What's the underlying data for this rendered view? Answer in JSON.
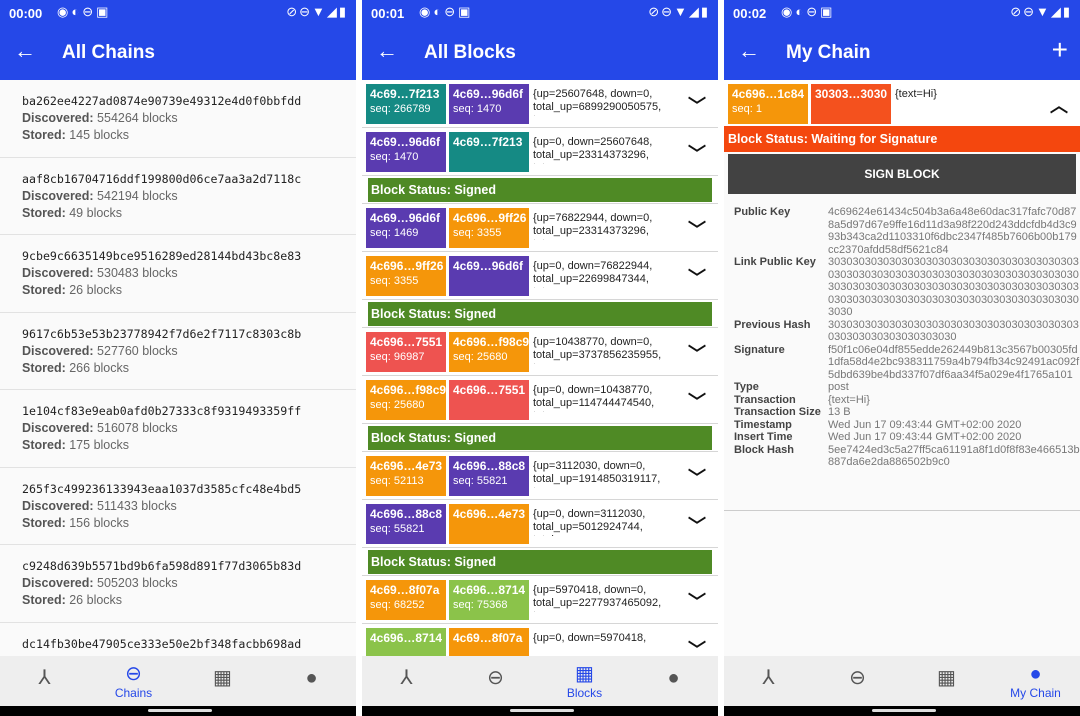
{
  "icons": {
    "back": "arrow-left-icon",
    "plus": "plus-icon",
    "chevron_down": "chevron-down-icon",
    "chevron_up": "chevron-up-icon"
  },
  "nav": {
    "items": [
      {
        "icon": "network-icon",
        "glyph": "⅄",
        "label": ""
      },
      {
        "icon": "link-icon",
        "glyph": "⊖",
        "label": "Chains"
      },
      {
        "icon": "grid-icon",
        "glyph": "▦",
        "label": "Blocks"
      },
      {
        "icon": "person-icon",
        "glyph": "●",
        "label": "My Chain"
      }
    ]
  },
  "screen1": {
    "time": "00:00",
    "title": "All Chains",
    "discovered_label": "Discovered:",
    "stored_label": "Stored:",
    "chains": [
      {
        "hash": "ba262ee4227ad0874e90739e49312e4d0f0bbfdd",
        "discovered": "554264 blocks",
        "stored": "145 blocks"
      },
      {
        "hash": "aaf8cb16704716ddf199800d06ce7aa3a2d7118c",
        "discovered": "542194 blocks",
        "stored": "49 blocks"
      },
      {
        "hash": "9cbe9c6635149bce9516289ed28144bd43bc8e83",
        "discovered": "530483 blocks",
        "stored": "26 blocks"
      },
      {
        "hash": "9617c6b53e53b23778942f7d6e2f7117c8303c8b",
        "discovered": "527760 blocks",
        "stored": "266 blocks"
      },
      {
        "hash": "1e104cf83e9eab0afd0b27333c8f9319493359ff",
        "discovered": "516078 blocks",
        "stored": "175 blocks"
      },
      {
        "hash": "265f3c499236133943eaa1037d3585cfc48e4bd5",
        "discovered": "511433 blocks",
        "stored": "156 blocks"
      },
      {
        "hash": "c9248d639b5571bd9b6fa598d891f77d3065b83d",
        "discovered": "505203 blocks",
        "stored": "26 blocks"
      },
      {
        "hash": "dc14fb30be47905ce333e50e2bf348facbb698ad",
        "discovered": "",
        "stored": ""
      }
    ]
  },
  "screen2": {
    "time": "00:01",
    "title": "All Blocks",
    "signed_text": "Block Status: Signed",
    "rows": [
      {
        "k1": "4c69…7f213",
        "c1": "#158a84",
        "s1": "seq: 266789",
        "k2": "4c69…96d6f",
        "c2": "#5a3bb0",
        "s2": "seq: 1470",
        "info": "{up=25607648, down=0, total_up=6899290050575, t…",
        "signed_after": false
      },
      {
        "k1": "4c69…96d6f",
        "c1": "#5a3bb0",
        "s1": "seq: 1470",
        "k2": "4c69…7f213",
        "c2": "#158a84",
        "s2": "",
        "info": "{up=0, down=25607648, total_up=23314373296, tota…",
        "signed_after": true
      },
      {
        "k1": "4c69…96d6f",
        "c1": "#5a3bb0",
        "s1": "seq: 1469",
        "k2": "4c696…9ff26",
        "c2": "#f5960a",
        "s2": "seq: 3355",
        "info": "{up=76822944, down=0, total_up=23314373296, tota…",
        "signed_after": false
      },
      {
        "k1": "4c696…9ff26",
        "c1": "#f5960a",
        "s1": "seq: 3355",
        "k2": "4c69…96d6f",
        "c2": "#5a3bb0",
        "s2": "",
        "info": "{up=0, down=76822944, total_up=22699847344, tota…",
        "signed_after": true
      },
      {
        "k1": "4c696…7551",
        "c1": "#ee5350",
        "s1": "seq: 96987",
        "k2": "4c696…f98c9",
        "c2": "#f5960a",
        "s2": "seq: 25680",
        "info": "{up=10438770, down=0, total_up=3737856235955, t…",
        "signed_after": false
      },
      {
        "k1": "4c696…f98c9",
        "c1": "#f5960a",
        "s1": "seq: 25680",
        "k2": "4c696…7551",
        "c2": "#ee5350",
        "s2": "",
        "info": "{up=0, down=10438770, total_up=114744474540, tot…",
        "signed_after": true
      },
      {
        "k1": "4c696…4e73",
        "c1": "#f5960a",
        "s1": "seq: 52113",
        "k2": "4c696…88c8",
        "c2": "#5a3bb0",
        "s2": "seq: 55821",
        "info": "{up=3112030, down=0, total_up=1914850319117, t…",
        "signed_after": false
      },
      {
        "k1": "4c696…88c8",
        "c1": "#5a3bb0",
        "s1": "seq: 55821",
        "k2": "4c696…4e73",
        "c2": "#f5960a",
        "s2": "",
        "info": "{up=0, down=3112030, total_up=5012924744, total_…",
        "signed_after": true
      },
      {
        "k1": "4c69…8f07a",
        "c1": "#f5960a",
        "s1": "seq: 68252",
        "k2": "4c696…8714",
        "c2": "#8bc34a",
        "s2": "seq: 75368",
        "info": "{up=5970418, down=0, total_up=2277937465092, t…",
        "signed_after": false
      },
      {
        "k1": "4c696…8714",
        "c1": "#8bc34a",
        "s1": "",
        "k2": "4c69…8f07a",
        "c2": "#f5960a",
        "s2": "",
        "info": "{up=0, down=5970418,",
        "signed_after": false
      }
    ]
  },
  "screen3": {
    "time": "00:02",
    "title": "My Chain",
    "block": {
      "k1": "4c696…1c84",
      "s1": "seq: 1",
      "k2": "30303…3030",
      "info": "{text=Hi}"
    },
    "status_text": "Block Status: Waiting for Signature",
    "sign_label": "SIGN BLOCK",
    "details": [
      {
        "key": "Public Key",
        "value": "4c69624e61434c504b3a6a48e60dac317fafc70d878a5d97d67e9ffe16d11d3a98f220d243ddcfdb4d3c993b343ca2d1103310f6dbc2347f485b7606b00b179cc2370afdd58df5621c84"
      },
      {
        "key": "Link Public Key",
        "value": "303030303030303030303030303030303030303030303030303030303030303030303030303030303030303030303030303030303030303030303030303030303030303030303030303030303030303030303030"
      },
      {
        "key": "Previous Hash",
        "value": "30303030303030303030303030303030303030303030303030303030303030"
      },
      {
        "key": "Signature",
        "value": "f50f1c06e04df855edde262449b813c3567b00305fd1dfa58d4e2bc938311759a4b794fb34c92491ac092f5dbd639be4bd337f07df6aa34f5a029e4f1765a101"
      },
      {
        "key": "Type",
        "value": "post"
      },
      {
        "key": "Transaction",
        "value": "{text=Hi}"
      },
      {
        "key": "Transaction Size",
        "value": "13 B"
      },
      {
        "key": "Timestamp",
        "value": "Wed Jun 17 09:43:44 GMT+02:00 2020"
      },
      {
        "key": "Insert Time",
        "value": "Wed Jun 17 09:43:44 GMT+02:00 2020"
      },
      {
        "key": "Block Hash",
        "value": "5ee7424ed3c5a27ff5ca61191a8f1d0f8f83e466513b887da6e2da886502b9c0"
      }
    ]
  },
  "colors": {
    "primary": "#2548e8",
    "signed": "#4f8a25",
    "waiting": "#f4470e",
    "sign_button": "#424242"
  }
}
